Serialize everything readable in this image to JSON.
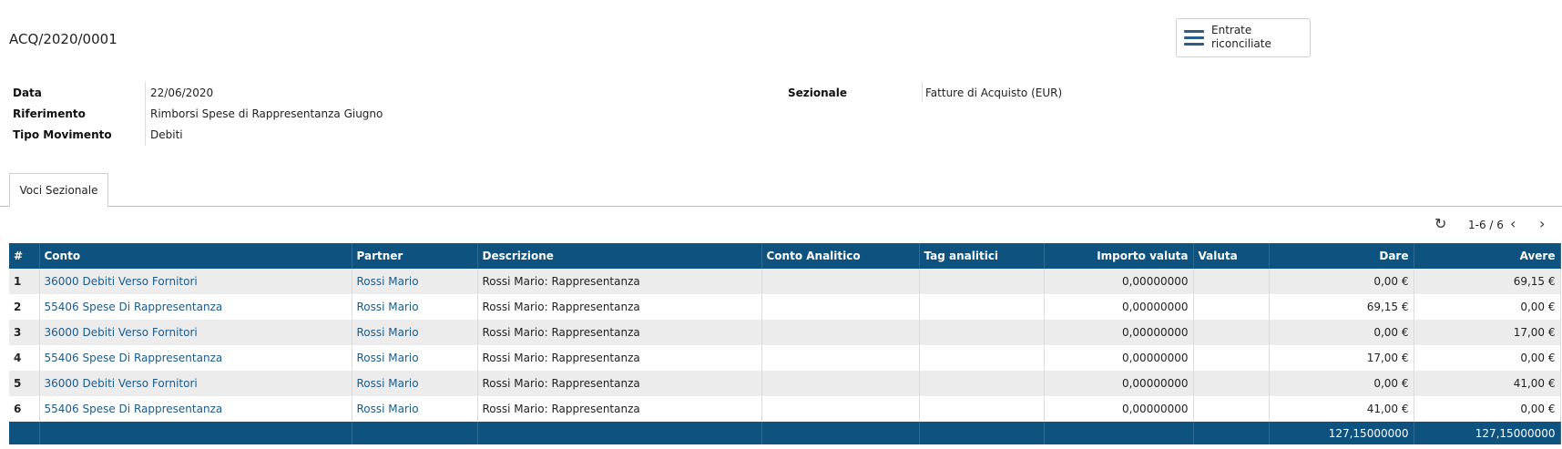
{
  "record": {
    "title": "ACQ/2020/0001",
    "smart_button": "Entrate riconciliate"
  },
  "fields": {
    "data_label": "Data",
    "data_value": "22/06/2020",
    "riferimento_label": "Riferimento",
    "riferimento_value": "Rimborsi Spese di Rappresentanza Giugno",
    "tipo_label": "Tipo Movimento",
    "tipo_value": "Debiti",
    "sezionale_label": "Sezionale",
    "sezionale_value": "Fatture di Acquisto (EUR)"
  },
  "tabs": [
    {
      "label": "Voci Sezionale"
    }
  ],
  "pager": {
    "range": "1-6 / 6"
  },
  "icons": {
    "refresh": "refresh-icon",
    "prev": "chevron-left-icon",
    "next": "chevron-right-icon",
    "menu": "list-icon"
  },
  "table": {
    "headers": {
      "num": "#",
      "conto": "Conto",
      "partner": "Partner",
      "descrizione": "Descrizione",
      "conto_analitico": "Conto Analitico",
      "tag": "Tag analitici",
      "importo": "Importo valuta",
      "valuta": "Valuta",
      "dare": "Dare",
      "avere": "Avere"
    },
    "rows": [
      {
        "n": "1",
        "conto": "36000 Debiti Verso Fornitori",
        "partner": "Rossi Mario",
        "descrizione": "Rossi Mario: Rappresentanza",
        "conto_analitico": "",
        "tag": "",
        "importo": "0,00000000",
        "valuta": "",
        "dare": "0,00 €",
        "avere": "69,15 €"
      },
      {
        "n": "2",
        "conto": "55406 Spese Di Rappresentanza",
        "partner": "Rossi Mario",
        "descrizione": "Rossi Mario: Rappresentanza",
        "conto_analitico": "",
        "tag": "",
        "importo": "0,00000000",
        "valuta": "",
        "dare": "69,15 €",
        "avere": "0,00 €"
      },
      {
        "n": "3",
        "conto": "36000 Debiti Verso Fornitori",
        "partner": "Rossi Mario",
        "descrizione": "Rossi Mario: Rappresentanza",
        "conto_analitico": "",
        "tag": "",
        "importo": "0,00000000",
        "valuta": "",
        "dare": "0,00 €",
        "avere": "17,00 €"
      },
      {
        "n": "4",
        "conto": "55406 Spese Di Rappresentanza",
        "partner": "Rossi Mario",
        "descrizione": "Rossi Mario: Rappresentanza",
        "conto_analitico": "",
        "tag": "",
        "importo": "0,00000000",
        "valuta": "",
        "dare": "17,00 €",
        "avere": "0,00 €"
      },
      {
        "n": "5",
        "conto": "36000 Debiti Verso Fornitori",
        "partner": "Rossi Mario",
        "descrizione": "Rossi Mario: Rappresentanza",
        "conto_analitico": "",
        "tag": "",
        "importo": "0,00000000",
        "valuta": "",
        "dare": "0,00 €",
        "avere": "41,00 €"
      },
      {
        "n": "6",
        "conto": "55406 Spese Di Rappresentanza",
        "partner": "Rossi Mario",
        "descrizione": "Rossi Mario: Rappresentanza",
        "conto_analitico": "",
        "tag": "",
        "importo": "0,00000000",
        "valuta": "",
        "dare": "41,00 €",
        "avere": "0,00 €"
      }
    ],
    "totals": {
      "dare": "127,15000000",
      "avere": "127,15000000"
    }
  },
  "colors": {
    "header_bg": "#0e5280",
    "link": "#1c5a8b",
    "row_alt": "#ececec"
  }
}
